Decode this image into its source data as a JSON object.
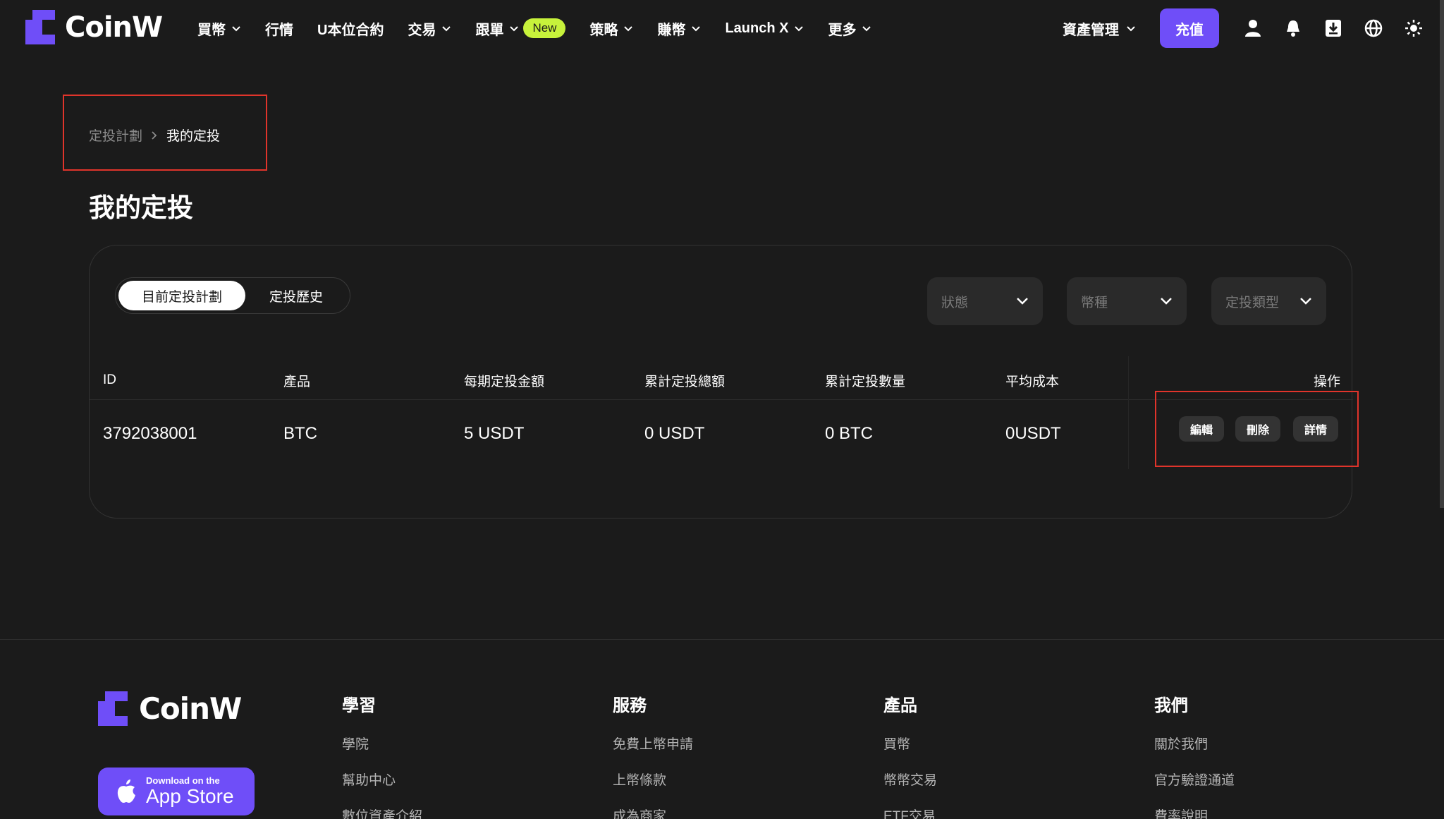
{
  "brand": {
    "name": "CoinW",
    "accent": "#6f4ef8"
  },
  "nav": {
    "items": [
      {
        "label": "買幣",
        "dropdown": true
      },
      {
        "label": "行情",
        "dropdown": false
      },
      {
        "label": "U本位合約",
        "dropdown": false
      },
      {
        "label": "交易",
        "dropdown": true
      },
      {
        "label": "跟單",
        "dropdown": true,
        "badge": "New"
      },
      {
        "label": "策略",
        "dropdown": true
      },
      {
        "label": "賺幣",
        "dropdown": true
      },
      {
        "label": "Launch X",
        "dropdown": true
      },
      {
        "label": "更多",
        "dropdown": true
      }
    ],
    "asset_management": "資產管理",
    "deposit": "充值",
    "icons": [
      "user-icon",
      "bell-icon",
      "download-icon",
      "globe-icon",
      "sun-icon"
    ]
  },
  "breadcrumb": {
    "parent": "定投計劃",
    "current": "我的定投"
  },
  "page_title": "我的定投",
  "tabs": {
    "active": "目前定投計劃",
    "inactive": "定投歷史"
  },
  "filters": {
    "status": "狀態",
    "coin": "幣種",
    "type": "定投類型"
  },
  "table": {
    "headers": {
      "id": "ID",
      "product": "產品",
      "amount_per_period": "每期定投金額",
      "total_invested": "累計定投總額",
      "total_quantity": "累計定投數量",
      "avg_cost": "平均成本",
      "actions": "操作"
    },
    "rows": [
      {
        "id": "3792038001",
        "product": "BTC",
        "amount_per_period": "5 USDT",
        "total_invested": "0 USDT",
        "total_quantity": "0 BTC",
        "avg_cost": "0USDT"
      }
    ],
    "actions": {
      "edit": "編輯",
      "delete": "刪除",
      "details": "詳情"
    }
  },
  "footer": {
    "brand": "CoinW",
    "appstore": {
      "small": "Download on the",
      "big": "App Store"
    },
    "columns": [
      {
        "title": "學習",
        "links": [
          "學院",
          "幫助中心",
          "數位資產介紹"
        ]
      },
      {
        "title": "服務",
        "links": [
          "免費上幣申請",
          "上幣條款",
          "成為商家"
        ]
      },
      {
        "title": "產品",
        "links": [
          "買幣",
          "幣幣交易",
          "ETF交易"
        ]
      },
      {
        "title": "我們",
        "links": [
          "關於我們",
          "官方驗證通道",
          "費率說明"
        ]
      }
    ]
  }
}
